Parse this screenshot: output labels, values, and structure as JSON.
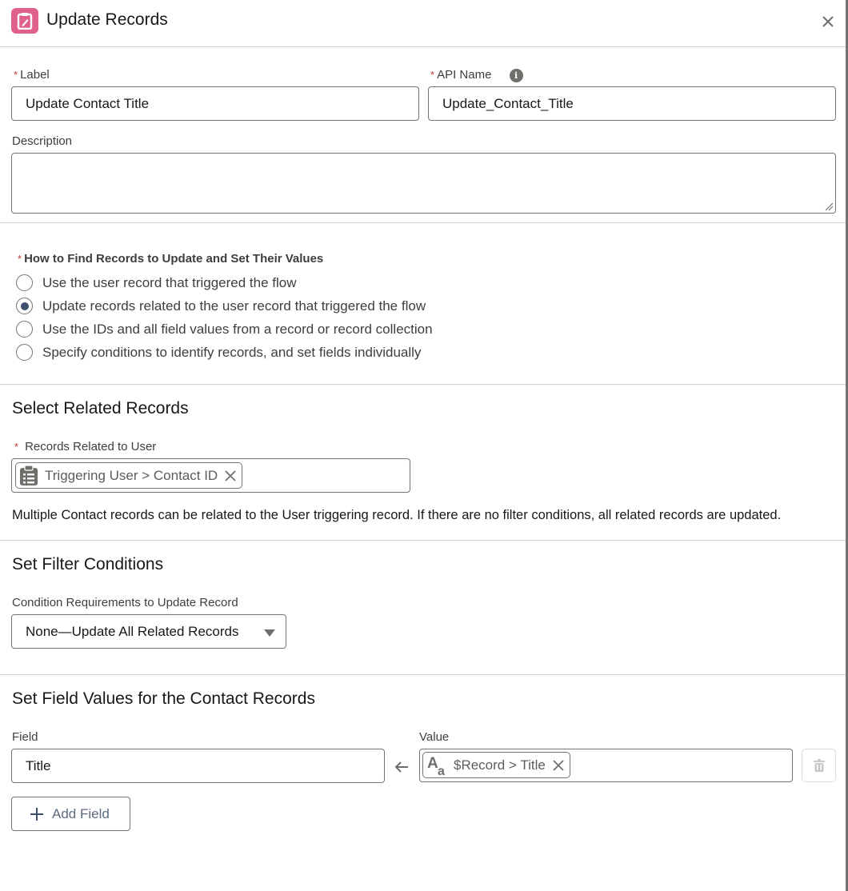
{
  "header": {
    "title": "Update Records",
    "icon": "clipboard-edit-icon",
    "icon_color": "#e0628b",
    "close_icon": "close-icon"
  },
  "form": {
    "label": {
      "label": "Label",
      "required_mark": "*",
      "value": "Update Contact Title"
    },
    "api_name": {
      "label": "API Name",
      "required_mark": "*",
      "value": "Update_Contact_Title",
      "info_icon": "i"
    },
    "description": {
      "label": "Description",
      "value": ""
    }
  },
  "find_records": {
    "required_mark": "*",
    "label": "How to Find Records to Update and Set Their Values",
    "options": [
      {
        "label": "Use the user record that triggered the flow",
        "checked": false
      },
      {
        "label": "Update records related to the user record that triggered the flow",
        "checked": true
      },
      {
        "label": "Use the IDs and all field values from a record or record collection",
        "checked": false
      },
      {
        "label": "Specify conditions to identify records, and set fields individually",
        "checked": false
      }
    ]
  },
  "related_records": {
    "title": "Select Related Records",
    "field_label": "Records Related to User",
    "required_mark": "*",
    "pill": {
      "icon": "record-lookup-icon",
      "text": "Triggering User > Contact ID"
    },
    "help_text": "Multiple Contact records can be related to the User triggering record. If there are no filter conditions, all related records are updated."
  },
  "filter": {
    "title": "Set Filter Conditions",
    "field_label": "Condition Requirements to Update Record",
    "selected": "None—Update All Related Records"
  },
  "field_values": {
    "title": "Set Field Values for the Contact Records",
    "field_label": "Field",
    "value_label": "Value",
    "rows": [
      {
        "field": "Title",
        "value_pill": {
          "icon": "text-type-icon",
          "text": "$Record > Title"
        }
      }
    ],
    "add_button": "Add Field"
  },
  "colors": {
    "accent": "#e0628b",
    "radio_checked": "#3c4f70",
    "border": "#747474",
    "required": "#c23934"
  }
}
